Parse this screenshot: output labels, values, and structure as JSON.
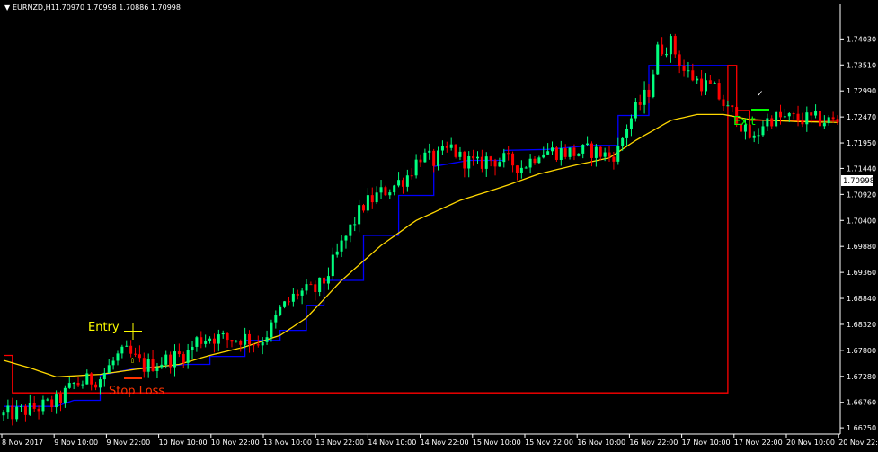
{
  "header": {
    "symbol_label": "EURNZD,H1",
    "ohlc_label": "1.70970 1.70998 1.70886 1.70998"
  },
  "colors": {
    "background": "#000000",
    "axis": "#ffffff",
    "bull": "#00ff7f",
    "bear": "#ff0000",
    "trailing_up": "#0000ff",
    "trailing_down": "#ff0000",
    "moving_average": "#ffd700",
    "entry": "#ffff00",
    "stop_loss": "#ff3300",
    "exit": "#00ff00"
  },
  "annotations": {
    "entry_label": "Entry",
    "stop_loss_label": "Stop Loss",
    "exit_label": "Exit"
  },
  "chart_data": {
    "type": "candlestick",
    "ylim": [
      1.6618,
      1.7445
    ],
    "yticks": [
      "1.74030",
      "1.73510",
      "1.72990",
      "1.72470",
      "1.71950",
      "1.71440",
      "1.70920",
      "1.70400",
      "1.69880",
      "1.69360",
      "1.68840",
      "1.68320",
      "1.67800",
      "1.67280",
      "1.66760",
      "1.66250"
    ],
    "current_price": "1.70998",
    "xticks": [
      "8 Nov 2017",
      "9 Nov 10:00",
      "9 Nov 22:00",
      "10 Nov 10:00",
      "10 Nov 22:00",
      "13 Nov 10:00",
      "13 Nov 22:00",
      "14 Nov 10:00",
      "14 Nov 22:00",
      "15 Nov 10:00",
      "15 Nov 22:00",
      "16 Nov 10:00",
      "16 Nov 22:00",
      "17 Nov 10:00",
      "17 Nov 22:00",
      "20 Nov 10:00",
      "20 Nov 22:00"
    ],
    "series": [
      {
        "name": "trailing_stop",
        "anchors_up": [
          [
            0,
            1.6668
          ],
          [
            12,
            1.6668
          ],
          [
            16,
            1.668
          ],
          [
            22,
            1.673
          ],
          [
            30,
            1.6744
          ],
          [
            42,
            1.6752
          ],
          [
            47,
            1.6768
          ],
          [
            55,
            1.68
          ],
          [
            63,
            1.682
          ],
          [
            69,
            1.687
          ],
          [
            73,
            1.692
          ],
          [
            82,
            1.701
          ],
          [
            90,
            1.709
          ],
          [
            98,
            1.7148
          ],
          [
            106,
            1.716
          ],
          [
            114,
            1.718
          ],
          [
            124,
            1.7182
          ],
          [
            134,
            1.719
          ],
          [
            140,
            1.725
          ],
          [
            147,
            1.735
          ],
          [
            165,
            1.735
          ]
        ],
        "anchors_down": [
          [
            0,
            1.677
          ],
          [
            2,
            1.6695
          ],
          [
            12,
            1.6695
          ],
          [
            165,
            1.735
          ],
          [
            167,
            1.726
          ],
          [
            170,
            1.724
          ],
          [
            190,
            1.724
          ]
        ]
      },
      {
        "name": "moving_average",
        "anchors": [
          [
            0,
            1.676
          ],
          [
            6,
            1.6745
          ],
          [
            12,
            1.6727
          ],
          [
            22,
            1.6732
          ],
          [
            30,
            1.6742
          ],
          [
            40,
            1.6752
          ],
          [
            47,
            1.677
          ],
          [
            55,
            1.6787
          ],
          [
            63,
            1.681
          ],
          [
            69,
            1.6845
          ],
          [
            77,
            1.692
          ],
          [
            86,
            1.699
          ],
          [
            94,
            1.704
          ],
          [
            104,
            1.708
          ],
          [
            114,
            1.7108
          ],
          [
            122,
            1.7133
          ],
          [
            130,
            1.715
          ],
          [
            138,
            1.7165
          ],
          [
            144,
            1.72
          ],
          [
            152,
            1.724
          ],
          [
            158,
            1.7252
          ],
          [
            164,
            1.7252
          ],
          [
            170,
            1.7242
          ],
          [
            180,
            1.7238
          ],
          [
            190,
            1.7236
          ]
        ]
      },
      {
        "name": "price_path",
        "anchors": [
          [
            0,
            1.665
          ],
          [
            6,
            1.6662
          ],
          [
            12,
            1.6675
          ],
          [
            16,
            1.6712
          ],
          [
            22,
            1.6725
          ],
          [
            26,
            1.6768
          ],
          [
            28,
            1.6775
          ],
          [
            32,
            1.6748
          ],
          [
            36,
            1.6758
          ],
          [
            42,
            1.6775
          ],
          [
            44,
            1.68
          ],
          [
            47,
            1.6808
          ],
          [
            51,
            1.6802
          ],
          [
            55,
            1.6805
          ],
          [
            58,
            1.6795
          ],
          [
            61,
            1.6825
          ],
          [
            63,
            1.686
          ],
          [
            67,
            1.6895
          ],
          [
            71,
            1.69
          ],
          [
            73,
            1.6918
          ],
          [
            77,
            1.699
          ],
          [
            80,
            1.704
          ],
          [
            82,
            1.707
          ],
          [
            86,
            1.7095
          ],
          [
            89,
            1.711
          ],
          [
            92,
            1.713
          ],
          [
            95,
            1.717
          ],
          [
            98,
            1.7158
          ],
          [
            102,
            1.7185
          ],
          [
            104,
            1.7165
          ],
          [
            108,
            1.715
          ],
          [
            110,
            1.7162
          ],
          [
            114,
            1.716
          ],
          [
            118,
            1.7148
          ],
          [
            120,
            1.716
          ],
          [
            122,
            1.718
          ],
          [
            126,
            1.7178
          ],
          [
            130,
            1.7175
          ],
          [
            134,
            1.718
          ],
          [
            138,
            1.7168
          ],
          [
            140,
            1.718
          ],
          [
            142,
            1.723
          ],
          [
            144,
            1.726
          ],
          [
            147,
            1.73
          ],
          [
            149,
            1.738
          ],
          [
            152,
            1.7395
          ],
          [
            155,
            1.734
          ],
          [
            158,
            1.732
          ],
          [
            162,
            1.73
          ],
          [
            165,
            1.726
          ],
          [
            167,
            1.725
          ],
          [
            169,
            1.7215
          ],
          [
            171,
            1.72
          ],
          [
            173,
            1.7235
          ],
          [
            175,
            1.7245
          ],
          [
            180,
            1.7243
          ],
          [
            185,
            1.7241
          ],
          [
            190,
            1.7238
          ]
        ]
      }
    ]
  }
}
